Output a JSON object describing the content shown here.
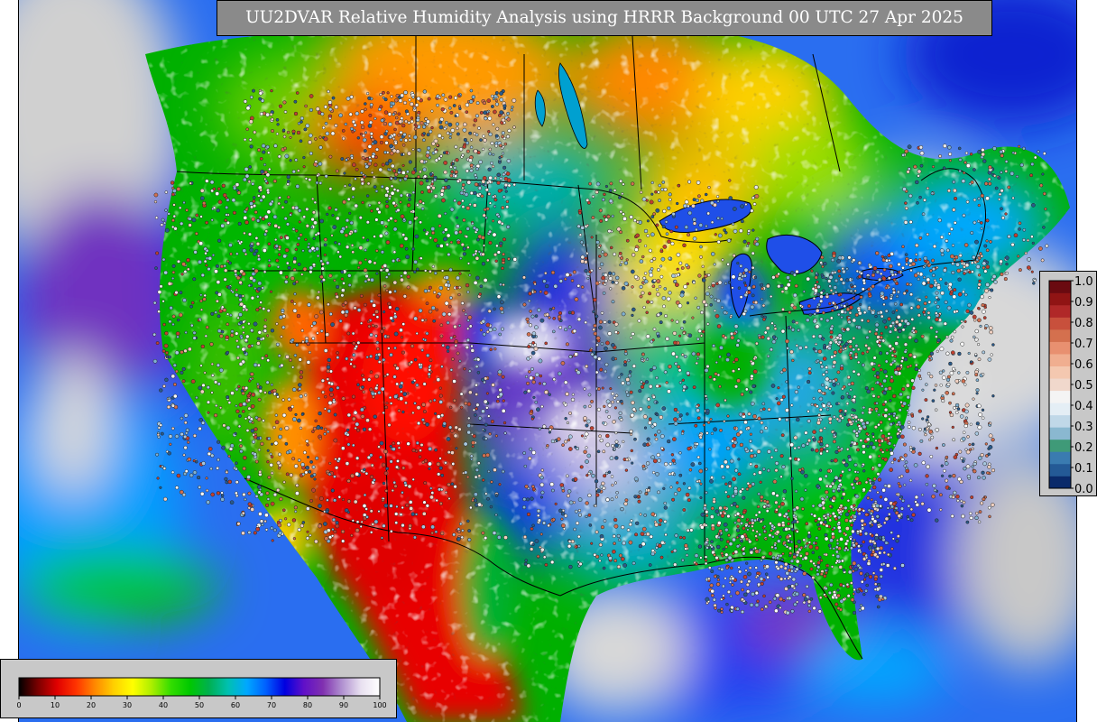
{
  "title": "UU2DVAR Relative Humidity Analysis using HRRR Background 00 UTC 27 Apr 2025",
  "field_colorbar": {
    "ticks": [
      "0",
      "10",
      "20",
      "30",
      "40",
      "50",
      "60",
      "70",
      "80",
      "90",
      "100"
    ],
    "stops": [
      "#000000",
      "#7a0000",
      "#e00000",
      "#ff3300",
      "#ff8800",
      "#ffd000",
      "#ffff00",
      "#aaee00",
      "#33dd00",
      "#00c800",
      "#00b050",
      "#00c0b0",
      "#00a8ff",
      "#0060ff",
      "#0000e0",
      "#6010c8",
      "#8030b0",
      "#b090d0",
      "#e8e0f0",
      "#ffffff"
    ]
  },
  "innovation_colorbar": {
    "ticks": [
      "0.0",
      "0.1",
      "0.2",
      "0.3",
      "0.4",
      "0.5",
      "0.6",
      "0.7",
      "0.8",
      "0.9",
      "1.0"
    ],
    "colors": [
      "#0a2a6a",
      "#245a96",
      "#3a7bb0",
      "#3f9a78",
      "#8ab8d0",
      "#c0d8e8",
      "#e4eef5",
      "#f4f4f4",
      "#f0d8cc",
      "#f4c8b0",
      "#f0ae90",
      "#e89070",
      "#d4704e",
      "#c8503c",
      "#b02828",
      "#901414",
      "#6a0a10"
    ]
  }
}
